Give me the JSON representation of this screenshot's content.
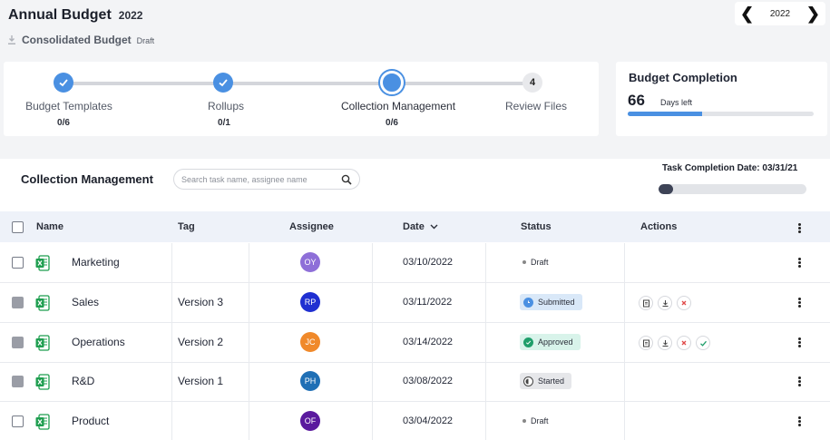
{
  "header": {
    "title": "Annual Budget",
    "year": "2022",
    "subtitle": "Consolidated Budget",
    "subtitle_status": "Draft"
  },
  "year_picker": {
    "value": "2022",
    "prev_icon": "chevron-left-icon",
    "next_icon": "chevron-right-icon"
  },
  "stepper": {
    "steps": [
      {
        "label": "Budget Templates",
        "count": "0/6",
        "state": "done"
      },
      {
        "label": "Rollups",
        "count": "0/1",
        "state": "done"
      },
      {
        "label": "Collection Management",
        "count": "0/6",
        "state": "current"
      },
      {
        "label": "Review Files",
        "number": "4",
        "state": "todo"
      }
    ]
  },
  "completion": {
    "title": "Budget Completion",
    "days": "66",
    "days_label": "Days left",
    "progress": 0.4
  },
  "collection": {
    "title": "Collection Management",
    "search_placeholder": "Search task name, assignee name",
    "task_completion_label": "Task Completion Date:",
    "task_completion_date": "03/31/21",
    "task_progress": 0.1
  },
  "table": {
    "headers": {
      "name": "Name",
      "tag": "Tag",
      "assignee": "Assignee",
      "date": "Date",
      "status": "Status",
      "actions": "Actions"
    },
    "rows": [
      {
        "name": "Marketing",
        "tag": "",
        "assignee": "OY",
        "avatar_color": "#8e6fd8",
        "date": "03/10/2022",
        "status": "Draft",
        "status_type": "draft",
        "checked": false,
        "actions": []
      },
      {
        "name": "Sales",
        "tag": "Version 3",
        "assignee": "RP",
        "avatar_color": "#1f2fd1",
        "date": "03/11/2022",
        "status": "Submitted",
        "status_type": "submitted",
        "checked": true,
        "actions": [
          "preview",
          "download",
          "reject"
        ]
      },
      {
        "name": "Operations",
        "tag": "Version 2",
        "assignee": "JC",
        "avatar_color": "#f0892a",
        "date": "03/14/2022",
        "status": "Approved",
        "status_type": "approved",
        "checked": true,
        "actions": [
          "preview",
          "download",
          "reject",
          "approve"
        ]
      },
      {
        "name": "R&D",
        "tag": "Version 1",
        "assignee": "PH",
        "avatar_color": "#1f6fb5",
        "date": "03/08/2022",
        "status": "Started",
        "status_type": "started",
        "checked": true,
        "actions": []
      },
      {
        "name": "Product",
        "tag": "",
        "assignee": "OF",
        "avatar_color": "#5a1a9e",
        "date": "03/04/2022",
        "status": "Draft",
        "status_type": "draft",
        "checked": false,
        "actions": []
      }
    ]
  },
  "colors": {
    "accent": "#4a90e2",
    "submitted_bg": "#d9e8f8",
    "approved_bg": "#d8f3ea",
    "started_bg": "#e6e7ea",
    "excel_green": "#1e9e4f"
  }
}
